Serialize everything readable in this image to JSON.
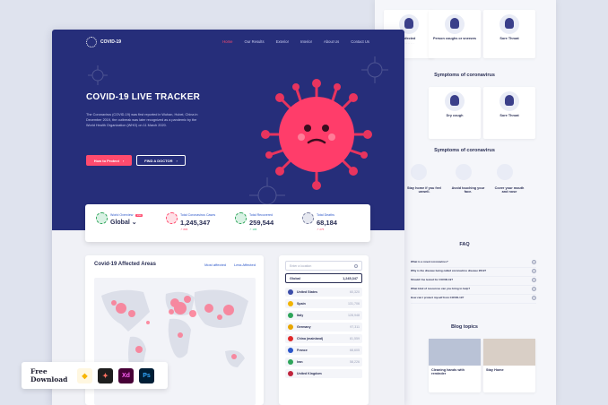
{
  "nav": {
    "brand": "COVID-19",
    "links": [
      "Home",
      "Our Results",
      "Exterior",
      "Interior",
      "About Us",
      "Contact Us"
    ],
    "active": "Home"
  },
  "hero": {
    "title": "COVID-19 LIVE TRACKER",
    "description": "The Coronavirus (COVID-19) was first reported in Wuhan, Hubei, China in December 2019, the outbreak was later recognized as a pandemic by the World Health Organization (WHO) on 11 March 2020.",
    "primary_button": "How to Protect",
    "secondary_button": "FIND A DOCTOR"
  },
  "stats": {
    "world": {
      "label": "World Overview",
      "badge": "Live",
      "value": "Global"
    },
    "total": {
      "label": "Total Coronavirus Cases",
      "value": "1,245,347",
      "change": "↗ 895"
    },
    "recovered": {
      "label": "Total Recovered",
      "value": "259,544",
      "change": "↗ 195"
    },
    "deaths": {
      "label": "Total Deaths",
      "value": "68,184",
      "change": "↗ 275"
    },
    "colors": {
      "up_red": "#ff4b6e",
      "up_green": "#2ec27e"
    }
  },
  "map": {
    "title": "Covid-19 Affected Areas",
    "tabs": [
      "Most affected",
      "Less Affected"
    ]
  },
  "countries": {
    "search_placeholder": "Enter a location",
    "global_label": "Global",
    "global_value": "1,245,347",
    "rows": [
      {
        "name": "United States",
        "count": "60,320",
        "color": "#3b4da8"
      },
      {
        "name": "Spain",
        "count": "131,706",
        "color": "#f2b400"
      },
      {
        "name": "Italy",
        "count": "128,948",
        "color": "#2ea55a"
      },
      {
        "name": "Germany",
        "count": "97,311",
        "color": "#e8a600"
      },
      {
        "name": "China (mainland)",
        "count": "81,559",
        "color": "#e02a2a"
      },
      {
        "name": "France",
        "count": "68,605",
        "color": "#2b56c9"
      },
      {
        "name": "Iran",
        "count": "58,226",
        "color": "#2ea55a"
      },
      {
        "name": "United Kingdom",
        "count": "",
        "color": "#c0243c"
      }
    ]
  },
  "sheet": {
    "top_cards": [
      "Infected",
      "Person coughs or sneezes",
      "Sore Throat"
    ],
    "symptoms_title": "Symptoms of coronavirus",
    "symptom_cards": [
      "Dry cough",
      "Sore Throat"
    ],
    "prevention_title": "Symptoms of coronavirus",
    "prevention": [
      "Stay home if you feel unwell.",
      "Avoid touching your face.",
      "Cover your mouth and nose"
    ],
    "faq_title": "FAQ",
    "faq_items": [
      "What is a novel coronavirus?",
      "Why is the disease being called coronavirus disease 2019?",
      "Should I be tested for COVID-19?",
      "What kind of resources can you bring to help?",
      "How can I protect myself from COVID-19?"
    ],
    "blog_title": "Blog topics",
    "blog_items": [
      "Cleaning hands with reminder",
      "Stay Home"
    ]
  },
  "download": {
    "label": "Free Download",
    "tools": [
      {
        "name": "sketch-icon",
        "glyph": "◆",
        "bg": "#fff7e0",
        "fg": "#f7b500"
      },
      {
        "name": "figma-icon",
        "glyph": "✦",
        "bg": "#1e1e1e",
        "fg": "#ff7262"
      },
      {
        "name": "xd-icon",
        "glyph": "Xd",
        "bg": "#470137",
        "fg": "#ff61f6"
      },
      {
        "name": "photoshop-icon",
        "glyph": "Ps",
        "bg": "#001e36",
        "fg": "#31a8ff"
      }
    ]
  }
}
